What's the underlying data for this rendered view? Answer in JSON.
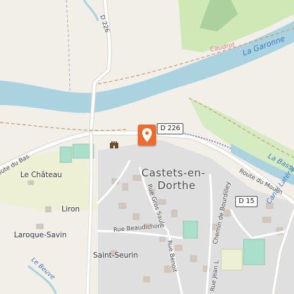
{
  "map": {
    "colors": {
      "water": "#aad3df",
      "land": "#f2efe9",
      "farmland": "#eef0d5",
      "forest": "#add19e",
      "residential": "#e0dfdf",
      "road": "#ffffff",
      "pitch": "#aae0cb",
      "marker": "#f06a2b"
    },
    "town": {
      "line1": "Castets-en-",
      "line2": "Dorthe"
    },
    "waterways": {
      "river": "La Garonne",
      "caudrot": "Caudrot",
      "canal_a": "La Bassan",
      "canal_b": "Canal Latéral",
      "stream": "Le Beuve"
    },
    "roads": {
      "d226_top": "D 226",
      "d226_shield": "D 226",
      "d15_shield": "D 15",
      "route_du_bas": "oute du Bas",
      "route_du_moulin": "Route du Moulin",
      "rue_gros_saule": "Rue Gros Saule",
      "rue_beaudichon": "Rue Beaudichon",
      "chemin_de_bourdilley": "Chemin de Bourdilley",
      "rue_benoit": "Rue Benoit",
      "rue_jean": "Rue Jean L"
    },
    "places": {
      "chateau": "Le Château",
      "liron": "Liron",
      "laroque": "Laroque-Savin",
      "saint_seurin": "Saint-Seurin"
    },
    "markers": {
      "poi": "location-pin-icon",
      "castle": "castle-icon"
    }
  }
}
